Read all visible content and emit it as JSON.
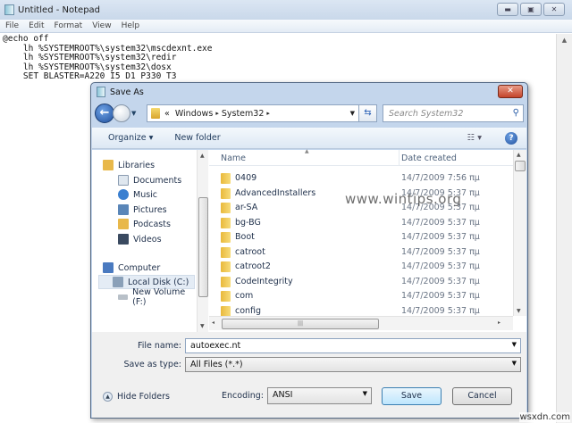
{
  "notepad": {
    "title": "Untitled - Notepad",
    "menu": [
      "File",
      "Edit",
      "Format",
      "View",
      "Help"
    ],
    "content": "@echo off\n    lh %SYSTEMROOT%\\system32\\mscdexnt.exe\n    lh %SYSTEMROOT%\\system32\\redir\n    lh %SYSTEMROOT%\\system32\\dosx\n    SET BLASTER=A220 I5 D1 P330 T3"
  },
  "dialog": {
    "title": "Save As",
    "close": "✕",
    "address": {
      "prefix": "«",
      "crumbs": [
        "Windows",
        "System32"
      ],
      "sep": "▸"
    },
    "search_placeholder": "Search System32",
    "toolbar": {
      "organize": "Organize ▾",
      "new_folder": "New folder"
    },
    "sidebar": [
      {
        "label": "Libraries",
        "icon": "libraries-icon",
        "color": "#e8b84a"
      },
      {
        "label": "Documents",
        "icon": "documents-icon",
        "color": "#dfe7ef"
      },
      {
        "label": "Music",
        "icon": "music-icon",
        "color": "#3a7fd0"
      },
      {
        "label": "Pictures",
        "icon": "pictures-icon",
        "color": "#5a86b8"
      },
      {
        "label": "Podcasts",
        "icon": "podcasts-icon",
        "color": "#e8b84a"
      },
      {
        "label": "Videos",
        "icon": "videos-icon",
        "color": "#3a4a60"
      },
      {
        "label": "Computer",
        "icon": "computer-icon",
        "color": "#4a7ac0"
      },
      {
        "label": "Local Disk (C:)",
        "icon": "local-disk-icon",
        "color": "#8aa0b8",
        "selected": true
      },
      {
        "label": "New Volume (F:)",
        "icon": "drive-icon",
        "color": "#b8c0c8"
      }
    ],
    "columns": {
      "name": "Name",
      "date": "Date created"
    },
    "files": [
      {
        "name": "0409",
        "date": "14/7/2009 7:56 πμ"
      },
      {
        "name": "AdvancedInstallers",
        "date": "14/7/2009 5:37 πμ"
      },
      {
        "name": "ar-SA",
        "date": "14/7/2009 5:37 πμ"
      },
      {
        "name": "bg-BG",
        "date": "14/7/2009 5:37 πμ"
      },
      {
        "name": "Boot",
        "date": "14/7/2009 5:37 πμ"
      },
      {
        "name": "catroot",
        "date": "14/7/2009 5:37 πμ"
      },
      {
        "name": "catroot2",
        "date": "14/7/2009 5:37 πμ"
      },
      {
        "name": "CodeIntegrity",
        "date": "14/7/2009 5:37 πμ"
      },
      {
        "name": "com",
        "date": "14/7/2009 5:37 πμ"
      },
      {
        "name": "config",
        "date": "14/7/2009 5:37 πμ"
      }
    ],
    "watermark": "www.wintips.org",
    "file_name_label": "File name:",
    "file_name": "autoexec.nt",
    "save_type_label": "Save as type:",
    "save_type": "All Files  (*.*)",
    "hide_folders": "Hide Folders",
    "encoding_label": "Encoding:",
    "encoding": "ANSI",
    "save": "Save",
    "cancel": "Cancel"
  },
  "corner_watermark": "wsxdn.com"
}
